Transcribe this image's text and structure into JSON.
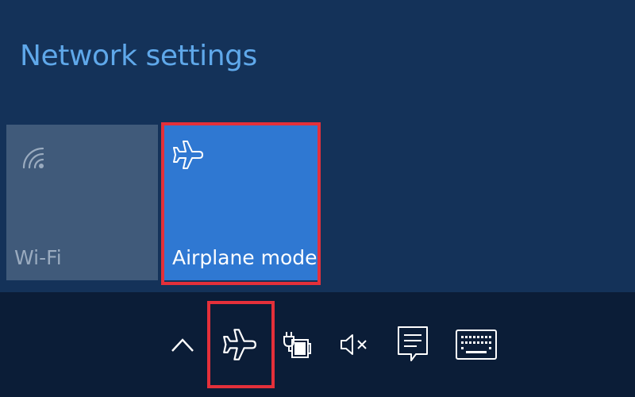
{
  "flyout": {
    "network_settings_label": "Network settings",
    "tiles": [
      {
        "label": "Wi-Fi",
        "icon": "wifi-icon",
        "state": "off"
      },
      {
        "label": "Airplane mode",
        "icon": "airplane-icon",
        "state": "on"
      }
    ]
  },
  "taskbar": {
    "tray_icons": [
      "chevron-up-icon",
      "airplane-icon",
      "battery-charging-icon",
      "volume-muted-icon",
      "action-center-icon",
      "touch-keyboard-icon"
    ]
  },
  "colors": {
    "flyout_bg": "#143259",
    "taskbar_bg": "#0b1d37",
    "accent": "#2f78d2",
    "link": "#5fa8ea",
    "tile_off": "#405a7a",
    "highlight": "#e4303a"
  }
}
